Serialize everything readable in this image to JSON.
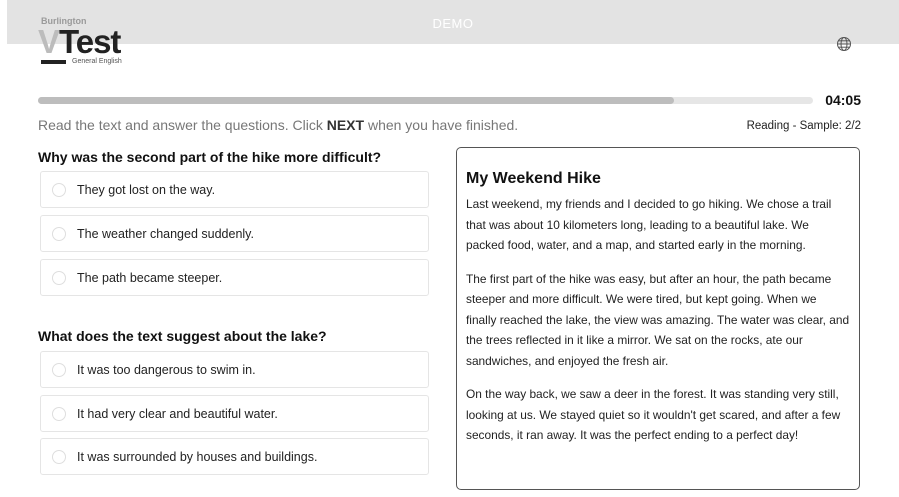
{
  "header": {
    "demo_label": "DEMO",
    "logo": {
      "brand_top": "Burlington",
      "brand_v": "V",
      "brand_main": "Test",
      "brand_sub": "General English"
    },
    "language_icon": "globe-icon"
  },
  "progress": {
    "fraction": 0.82,
    "timer": "04:05"
  },
  "instructions": {
    "before": "Read the text and answer the questions. Click ",
    "emphasis": "NEXT",
    "after": " when you have finished."
  },
  "section_label": "Reading - Sample: 2/2",
  "questions": [
    {
      "text": "Why was the second part of the hike more difficult?",
      "options": [
        "They got lost on the way.",
        "The weather changed suddenly.",
        "The path became steeper."
      ]
    },
    {
      "text": "What does the text suggest about the lake?",
      "options": [
        "It was too dangerous to swim in.",
        "It had very clear and beautiful water.",
        "It was surrounded by houses and buildings."
      ]
    }
  ],
  "passage": {
    "title": "My Weekend Hike",
    "paragraphs": [
      "Last weekend, my friends and I decided to go hiking. We chose a trail that was about 10 kilometers long, leading to a beautiful lake. We packed food, water, and a map, and started early in the morning.",
      "The first part of the hike was easy, but after an hour, the path became steeper and more difficult. We were tired, but kept going. When we finally reached the lake, the view was amazing. The water was clear, and the trees reflected in it like a mirror. We sat on the rocks, ate our sandwiches, and enjoyed the fresh air.",
      "On the way back, we saw a deer in the forest. It was standing very still, looking at us. We stayed quiet so it wouldn't get scared, and after a few seconds, it ran away. It was the perfect ending to a perfect day!"
    ]
  },
  "colors": {
    "progress_fill": "#bdbdbd",
    "progress_track": "#e6e6e6",
    "header_bg": "#e3e3e3"
  }
}
